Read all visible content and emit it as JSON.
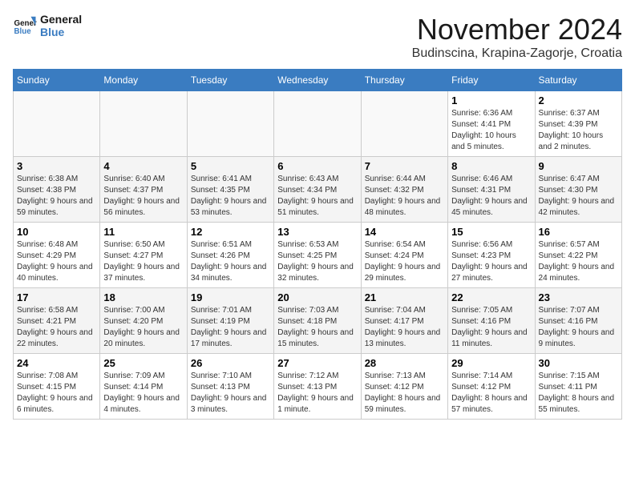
{
  "logo": {
    "line1": "General",
    "line2": "Blue"
  },
  "title": "November 2024",
  "location": "Budinscina, Krapina-Zagorje, Croatia",
  "days_of_week": [
    "Sunday",
    "Monday",
    "Tuesday",
    "Wednesday",
    "Thursday",
    "Friday",
    "Saturday"
  ],
  "weeks": [
    [
      {
        "day": "",
        "info": ""
      },
      {
        "day": "",
        "info": ""
      },
      {
        "day": "",
        "info": ""
      },
      {
        "day": "",
        "info": ""
      },
      {
        "day": "",
        "info": ""
      },
      {
        "day": "1",
        "info": "Sunrise: 6:36 AM\nSunset: 4:41 PM\nDaylight: 10 hours and 5 minutes."
      },
      {
        "day": "2",
        "info": "Sunrise: 6:37 AM\nSunset: 4:39 PM\nDaylight: 10 hours and 2 minutes."
      }
    ],
    [
      {
        "day": "3",
        "info": "Sunrise: 6:38 AM\nSunset: 4:38 PM\nDaylight: 9 hours and 59 minutes."
      },
      {
        "day": "4",
        "info": "Sunrise: 6:40 AM\nSunset: 4:37 PM\nDaylight: 9 hours and 56 minutes."
      },
      {
        "day": "5",
        "info": "Sunrise: 6:41 AM\nSunset: 4:35 PM\nDaylight: 9 hours and 53 minutes."
      },
      {
        "day": "6",
        "info": "Sunrise: 6:43 AM\nSunset: 4:34 PM\nDaylight: 9 hours and 51 minutes."
      },
      {
        "day": "7",
        "info": "Sunrise: 6:44 AM\nSunset: 4:32 PM\nDaylight: 9 hours and 48 minutes."
      },
      {
        "day": "8",
        "info": "Sunrise: 6:46 AM\nSunset: 4:31 PM\nDaylight: 9 hours and 45 minutes."
      },
      {
        "day": "9",
        "info": "Sunrise: 6:47 AM\nSunset: 4:30 PM\nDaylight: 9 hours and 42 minutes."
      }
    ],
    [
      {
        "day": "10",
        "info": "Sunrise: 6:48 AM\nSunset: 4:29 PM\nDaylight: 9 hours and 40 minutes."
      },
      {
        "day": "11",
        "info": "Sunrise: 6:50 AM\nSunset: 4:27 PM\nDaylight: 9 hours and 37 minutes."
      },
      {
        "day": "12",
        "info": "Sunrise: 6:51 AM\nSunset: 4:26 PM\nDaylight: 9 hours and 34 minutes."
      },
      {
        "day": "13",
        "info": "Sunrise: 6:53 AM\nSunset: 4:25 PM\nDaylight: 9 hours and 32 minutes."
      },
      {
        "day": "14",
        "info": "Sunrise: 6:54 AM\nSunset: 4:24 PM\nDaylight: 9 hours and 29 minutes."
      },
      {
        "day": "15",
        "info": "Sunrise: 6:56 AM\nSunset: 4:23 PM\nDaylight: 9 hours and 27 minutes."
      },
      {
        "day": "16",
        "info": "Sunrise: 6:57 AM\nSunset: 4:22 PM\nDaylight: 9 hours and 24 minutes."
      }
    ],
    [
      {
        "day": "17",
        "info": "Sunrise: 6:58 AM\nSunset: 4:21 PM\nDaylight: 9 hours and 22 minutes."
      },
      {
        "day": "18",
        "info": "Sunrise: 7:00 AM\nSunset: 4:20 PM\nDaylight: 9 hours and 20 minutes."
      },
      {
        "day": "19",
        "info": "Sunrise: 7:01 AM\nSunset: 4:19 PM\nDaylight: 9 hours and 17 minutes."
      },
      {
        "day": "20",
        "info": "Sunrise: 7:03 AM\nSunset: 4:18 PM\nDaylight: 9 hours and 15 minutes."
      },
      {
        "day": "21",
        "info": "Sunrise: 7:04 AM\nSunset: 4:17 PM\nDaylight: 9 hours and 13 minutes."
      },
      {
        "day": "22",
        "info": "Sunrise: 7:05 AM\nSunset: 4:16 PM\nDaylight: 9 hours and 11 minutes."
      },
      {
        "day": "23",
        "info": "Sunrise: 7:07 AM\nSunset: 4:16 PM\nDaylight: 9 hours and 9 minutes."
      }
    ],
    [
      {
        "day": "24",
        "info": "Sunrise: 7:08 AM\nSunset: 4:15 PM\nDaylight: 9 hours and 6 minutes."
      },
      {
        "day": "25",
        "info": "Sunrise: 7:09 AM\nSunset: 4:14 PM\nDaylight: 9 hours and 4 minutes."
      },
      {
        "day": "26",
        "info": "Sunrise: 7:10 AM\nSunset: 4:13 PM\nDaylight: 9 hours and 3 minutes."
      },
      {
        "day": "27",
        "info": "Sunrise: 7:12 AM\nSunset: 4:13 PM\nDaylight: 9 hours and 1 minute."
      },
      {
        "day": "28",
        "info": "Sunrise: 7:13 AM\nSunset: 4:12 PM\nDaylight: 8 hours and 59 minutes."
      },
      {
        "day": "29",
        "info": "Sunrise: 7:14 AM\nSunset: 4:12 PM\nDaylight: 8 hours and 57 minutes."
      },
      {
        "day": "30",
        "info": "Sunrise: 7:15 AM\nSunset: 4:11 PM\nDaylight: 8 hours and 55 minutes."
      }
    ]
  ]
}
